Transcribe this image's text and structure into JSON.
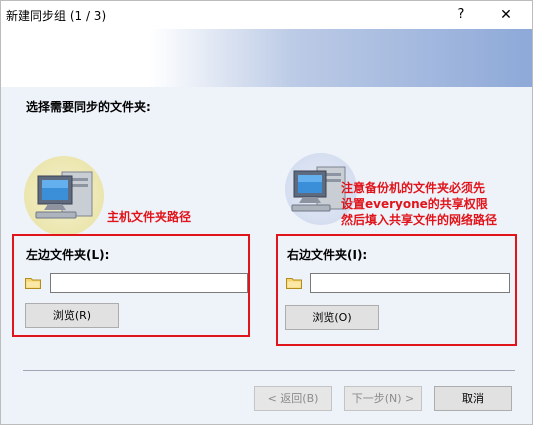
{
  "window": {
    "title": "新建同步组 (1 / 3)",
    "help_label": "?",
    "close_label": "✕"
  },
  "main": {
    "heading": "选择需要同步的文件夹:"
  },
  "annotations": {
    "left": "主机文件夹路径",
    "right_line1": "注意备份机的文件夹必须先",
    "right_line2": "设置everyone的共享权限",
    "right_line3": "然后填入共享文件的网络路径"
  },
  "left_folder": {
    "label": "左边文件夹(L):",
    "value": "",
    "browse_label": "浏览(R)"
  },
  "right_folder": {
    "label": "右边文件夹(I):",
    "value": "",
    "browse_label": "浏览(O)"
  },
  "footer": {
    "back_label": "< 返回(B)",
    "next_label": "下一步(N) >",
    "cancel_label": "取消"
  },
  "colors": {
    "annotation_red": "#e0141a",
    "banner_blue": "#8ea9d8"
  }
}
